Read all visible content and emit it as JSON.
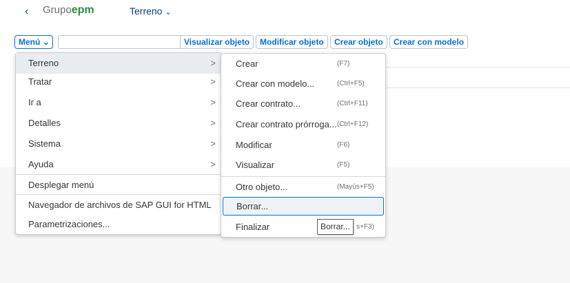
{
  "header": {
    "back_icon": "‹",
    "logo_prefix": "Grupo",
    "logo_suffix": "epm",
    "app_title": "Terreno",
    "title_chevron": "⌄"
  },
  "toolbar": {
    "menu_label": "Menú",
    "menu_chevron": "⌄",
    "select_value": "",
    "select_arrow": "⌄",
    "buttons": [
      "Visualizar objeto",
      "Modificar objeto",
      "Crear objeto",
      "Crear con modelo"
    ]
  },
  "main_menu": {
    "items": [
      {
        "label": "Terreno",
        "arrow": ">"
      },
      {
        "label": "Tratar",
        "arrow": ">"
      },
      {
        "label": "Ir a",
        "arrow": ">"
      },
      {
        "label": "Detalles",
        "arrow": ">"
      },
      {
        "label": "Sistema",
        "arrow": ">"
      },
      {
        "label": "Ayuda",
        "arrow": ">"
      },
      {
        "label": "Desplegar menú"
      },
      {
        "label": "Navegador de archivos de SAP GUI for HTML"
      },
      {
        "label": "Parametrizaciones..."
      }
    ]
  },
  "sub_menu": {
    "items": [
      {
        "label": "Crear",
        "shortcut": "(F7)"
      },
      {
        "label": "Crear con modelo...",
        "shortcut": "(Ctrl+F5)"
      },
      {
        "label": "Crear contrato...",
        "shortcut": "(Ctrl+F11)"
      },
      {
        "label": "Crear contrato prórroga...",
        "shortcut": "(Ctrl+F12)"
      },
      {
        "label": "Modificar",
        "shortcut": "(F6)"
      },
      {
        "label": "Visualizar",
        "shortcut": "(F5)"
      },
      {
        "label": "Otro objeto...",
        "shortcut": "(Mayús+F5)"
      },
      {
        "label": "Borrar...",
        "shortcut": ""
      },
      {
        "label": "Finalizar",
        "shortcut": "s+F3)"
      }
    ]
  },
  "tooltip": "Borrar...",
  "colors": {
    "accent": "#0a6ed1",
    "brand_green": "#2e8b3e",
    "title_blue": "#0a3f7a"
  }
}
